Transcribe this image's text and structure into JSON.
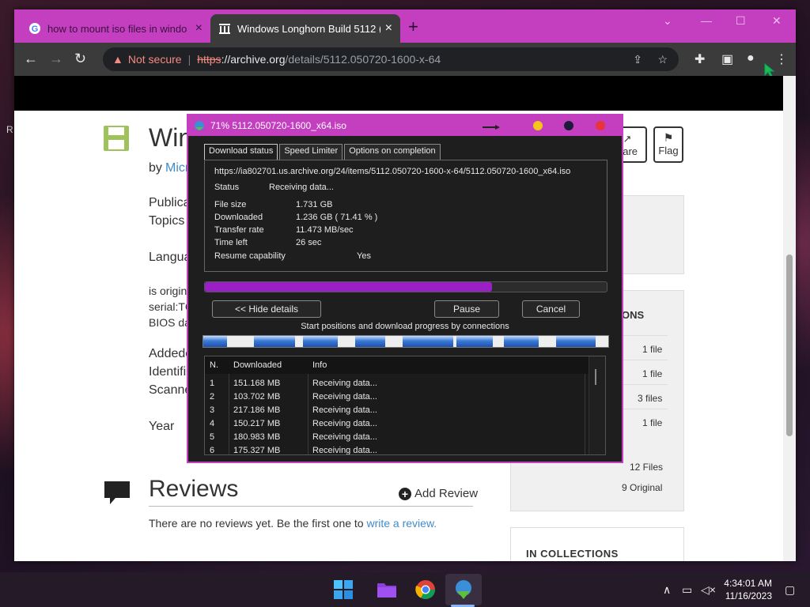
{
  "browser": {
    "tabs": [
      {
        "title": "how to mount iso files in windo",
        "icon": "google-g-icon"
      },
      {
        "title": "Windows Longhorn Build 5112 (",
        "icon": "archive-org-icon"
      }
    ],
    "address": {
      "warning": "Not secure",
      "scheme": "https",
      "host": "://archive.org",
      "path": "/details/5112.050720-1600-x-64"
    },
    "accent": "#c43fbf"
  },
  "page": {
    "title_fragment": "Win",
    "by_prefix": "by",
    "author_fragment": "Micr",
    "labels": [
      "Publica",
      "Topics",
      "Langua",
      "is origin",
      "serial:TC",
      "BIOS da",
      "Addede",
      "Identifi",
      "Scanne",
      "Year"
    ],
    "share_label": "hare",
    "flag_label": "Flag",
    "download_options_fragment": "ONS",
    "file_counts": [
      "1 file",
      "1 file",
      "3 files",
      "1 file"
    ],
    "total_files": "12 Files",
    "original_files": "9 Original",
    "in_collections": "IN COLLECTIONS",
    "reviews_title": "Reviews",
    "add_review": "Add Review",
    "no_reviews_text": "There are no reviews yet. Be the first one to",
    "write_review_link": "write a review.",
    "desktop_fragment": "R"
  },
  "idm": {
    "title": "71% 5112.050720-1600_x64.iso",
    "tabs": [
      "Download status",
      "Speed Limiter",
      "Options on completion"
    ],
    "url": "https://ia802701.us.archive.org/24/items/5112.050720-1600-x-64/5112.050720-1600_x64.iso",
    "status_label": "Status",
    "status_value": "Receiving data...",
    "file_size_label": "File size",
    "file_size_value": "1.731  GB",
    "downloaded_label": "Downloaded",
    "downloaded_value": "1.236  GB  ( 71.41 % )",
    "transfer_label": "Transfer rate",
    "transfer_value": "11.473  MB/sec",
    "time_left_label": "Time left",
    "time_left_value": "26 sec",
    "resume_label": "Resume capability",
    "resume_value": "Yes",
    "progress": 0.7141,
    "buttons": {
      "hide_details": "<< Hide details",
      "pause": "Pause",
      "cancel": "Cancel"
    },
    "connections_label": "Start positions and download progress by connections",
    "table_headers": [
      "N.",
      "Downloaded",
      "Info"
    ],
    "connections": [
      {
        "n": "1",
        "downloaded": "151.168  MB",
        "info": "Receiving data..."
      },
      {
        "n": "2",
        "downloaded": "103.702  MB",
        "info": "Receiving data..."
      },
      {
        "n": "3",
        "downloaded": "217.186  MB",
        "info": "Receiving data..."
      },
      {
        "n": "4",
        "downloaded": "150.217  MB",
        "info": "Receiving data..."
      },
      {
        "n": "5",
        "downloaded": "180.983  MB",
        "info": "Receiving data..."
      },
      {
        "n": "6",
        "downloaded": "175.327  MB",
        "info": "Receiving data..."
      }
    ]
  },
  "taskbar": {
    "time": "4:34:01 AM",
    "date": "11/16/2023",
    "apps": [
      "windows-start-icon",
      "files-folder-icon",
      "chrome-icon",
      "idm-icon"
    ]
  }
}
